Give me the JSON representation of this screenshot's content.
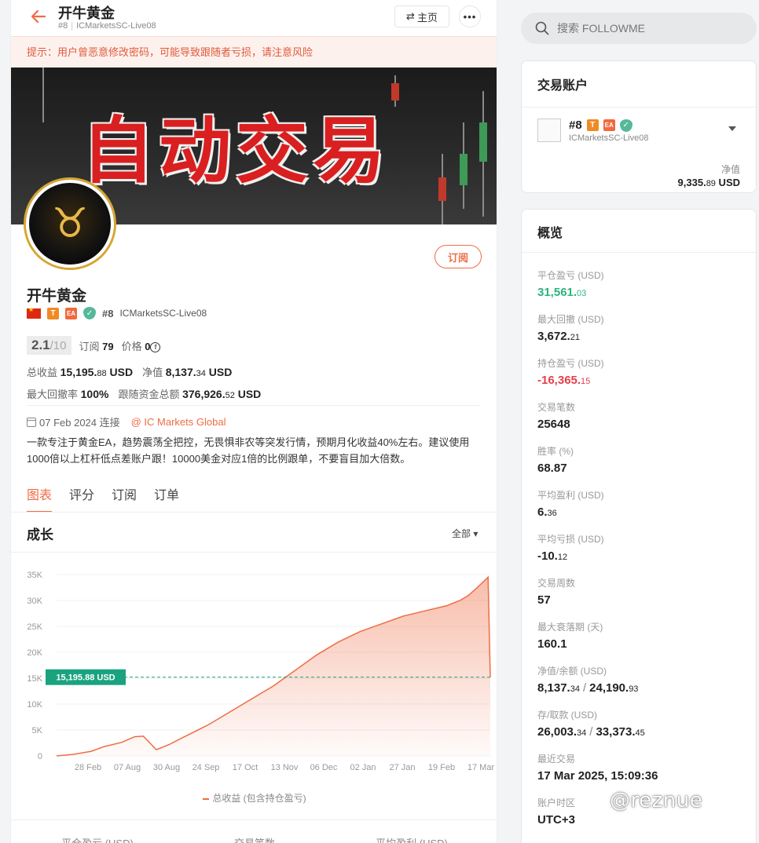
{
  "header": {
    "title": "开牛黄金",
    "rank": "#8",
    "account": "ICMarketsSC-Live08",
    "home_label": "主页",
    "more_label": "•••"
  },
  "warning": "提示：用户曾恶意修改密码，可能导致跟随者亏损，请注意风险",
  "banner_text": "自动交易",
  "subscribe_label": "订阅",
  "profile": {
    "name": "开牛黄金",
    "badge_t": "T",
    "badge_ea": "EA",
    "rank": "#8",
    "account": "ICMarketsSC-Live08",
    "score": "2.1",
    "score_max": "/10",
    "subs_label": "订阅",
    "subs_value": "79",
    "price_label": "价格",
    "price_value": "0",
    "total_label": "总收益",
    "total_value": "15,195.",
    "total_dec": "88",
    "total_unit": " USD",
    "equity_label": "净值",
    "equity_value": "8,137.",
    "equity_dec": "34",
    "equity_unit": " USD",
    "dd_label": "最大回撤率",
    "dd_value": "100%",
    "follow_label": "跟随资金总额",
    "follow_value": "376,926.",
    "follow_dec": "52",
    "follow_unit": " USD",
    "since": "07 Feb 2024 连接",
    "broker": "@ IC Markets Global",
    "description": "一款专注于黄金EA，趋势震荡全把控，无畏惧非农等突发行情，预期月化收益40%左右。建议使用1000倍以上杠杆低点差账户跟！10000美金对应1倍的比例跟单，不要盲目加大倍数。"
  },
  "tabs": [
    {
      "label": "图表",
      "active": true
    },
    {
      "label": "评分",
      "active": false
    },
    {
      "label": "订阅",
      "active": false
    },
    {
      "label": "订单",
      "active": false
    }
  ],
  "growth": {
    "title": "成长",
    "range": "全部 ▾",
    "legend": "总收益 (包含持仓盈亏)",
    "current_label": "15,195.88 USD"
  },
  "chart_data": {
    "type": "area",
    "x_ticks": [
      "28 Feb",
      "07 Aug",
      "30 Aug",
      "24 Sep",
      "17 Oct",
      "13 Nov",
      "06 Dec",
      "02 Jan",
      "27 Jan",
      "19 Feb",
      "17 Mar"
    ],
    "y_ticks": [
      "0",
      "5K",
      "10K",
      "15K",
      "20K",
      "25K",
      "30K",
      "35K"
    ],
    "ylim": [
      0,
      35000
    ],
    "series": [
      {
        "name": "总收益 (包含持仓盈亏)",
        "x": [
          0,
          0.4,
          0.8,
          1.1,
          1.5,
          1.8,
          2.0,
          2.3,
          2.6,
          2.9,
          3.5,
          4.0,
          4.5,
          5.0,
          5.5,
          6.0,
          6.5,
          7.0,
          7.5,
          8.0,
          8.5,
          9.0,
          9.3,
          9.5,
          9.7,
          9.95,
          10.0
        ],
        "values": [
          0,
          300,
          900,
          1800,
          2600,
          3700,
          3800,
          1200,
          2200,
          3500,
          6000,
          8500,
          11000,
          13500,
          16500,
          19500,
          22000,
          24000,
          25500,
          27000,
          28000,
          29000,
          30000,
          31000,
          32500,
          34500,
          15195.88
        ]
      }
    ],
    "reference_line": 15195.88,
    "xlabel": "",
    "ylabel": "",
    "grid": true
  },
  "bottom_stats": [
    "平仓盈亏 (USD)",
    "交易笔数",
    "平均盈利 (USD)"
  ],
  "search": {
    "placeholder": "搜索 FOLLOWME"
  },
  "account_card": {
    "title": "交易账户",
    "rank": "#8",
    "badge_t": "T",
    "badge_ea": "EA",
    "broker": "ICMarketsSC-Live08",
    "equity_label": "净值",
    "equity_value": "9,335.",
    "equity_dec": "89",
    "equity_unit": " USD"
  },
  "overview": {
    "title": "概览",
    "items": [
      {
        "label": "平仓盈亏 (USD)",
        "value": "31,561.",
        "dec": "03",
        "color": "green"
      },
      {
        "label": "最大回撤 (USD)",
        "value": "3,672.",
        "dec": "21",
        "color": ""
      },
      {
        "label": "持仓盈亏 (USD)",
        "value": "-16,365.",
        "dec": "15",
        "color": "red"
      },
      {
        "label": "交易笔数",
        "value": "25648",
        "dec": "",
        "color": ""
      },
      {
        "label": "胜率 (%)",
        "value": "68.87",
        "dec": "",
        "color": ""
      },
      {
        "label": "平均盈利 (USD)",
        "value": "6.",
        "dec": "36",
        "color": ""
      },
      {
        "label": "平均亏损 (USD)",
        "value": "-10.",
        "dec": "12",
        "color": ""
      },
      {
        "label": "交易周数",
        "value": "57",
        "dec": "",
        "color": ""
      },
      {
        "label": "最大衰落期 (天)",
        "value": "160.1",
        "dec": "",
        "color": ""
      },
      {
        "label": "净值/余额 (USD)",
        "value": "8,137.",
        "dec": "34",
        "value2": "24,190.",
        "dec2": "93",
        "color": ""
      },
      {
        "label": "存/取款 (USD)",
        "value": "26,003.",
        "dec": "34",
        "value2": "33,373.",
        "dec2": "45",
        "color": ""
      },
      {
        "label": "最近交易",
        "value": "17 Mar 2025, 15:09:36",
        "dec": "",
        "color": ""
      },
      {
        "label": "账户时区",
        "value": "UTC+3",
        "dec": "",
        "color": ""
      }
    ]
  },
  "watermark": "@reznue",
  "colors": {
    "accent": "#ef6c44",
    "green": "#2bb47f",
    "red": "#e4404c",
    "ref_label": "#1aa37e"
  }
}
